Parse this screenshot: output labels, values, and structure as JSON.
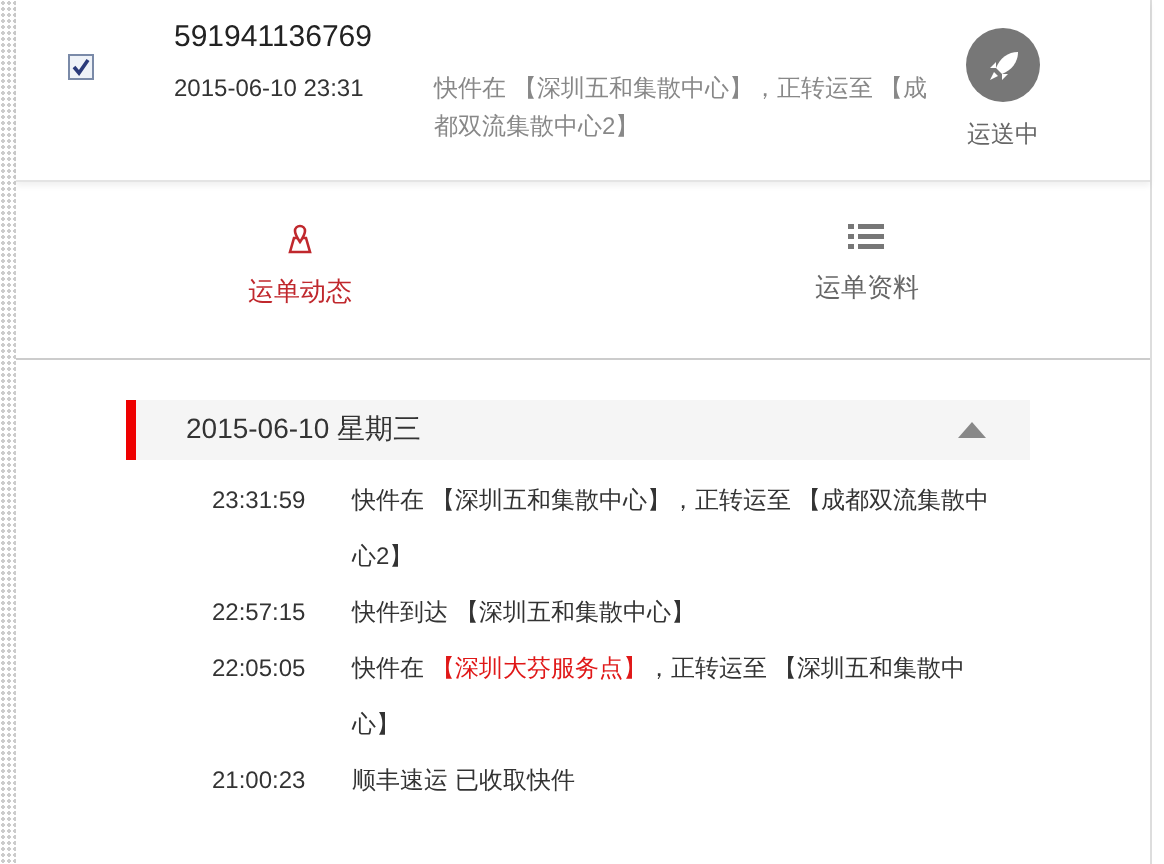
{
  "shipment": {
    "checked": true,
    "tracking_number": "591941136769",
    "time": "2015-06-10 23:31",
    "summary": "快件在 【深圳五和集散中心】，正转运至 【成都双流集散中心2】",
    "status": "运送中"
  },
  "tabs": [
    {
      "label": "运单动态",
      "kind": "map",
      "selected": true
    },
    {
      "label": "运单资料",
      "kind": "list",
      "selected": false
    }
  ],
  "day": {
    "date": "2015-06-10 星期三",
    "expanded": true,
    "events": [
      {
        "time": "23:31:59",
        "parts": [
          {
            "text": "快件在 【深圳五和集散中心】，正转运至 【成都双流集散中心2】",
            "highlight": false
          }
        ]
      },
      {
        "time": "22:57:15",
        "parts": [
          {
            "text": "快件到达 【深圳五和集散中心】",
            "highlight": false
          }
        ]
      },
      {
        "time": "22:05:05",
        "parts": [
          {
            "text": "快件在 ",
            "highlight": false
          },
          {
            "text": "【深圳大芬服务点】",
            "highlight": true
          },
          {
            "text": "，正转运至 【深圳五和集散中心】",
            "highlight": false
          }
        ]
      },
      {
        "time": "21:00:23",
        "parts": [
          {
            "text": "顺丰速运 已收取快件",
            "highlight": false
          }
        ]
      }
    ]
  }
}
